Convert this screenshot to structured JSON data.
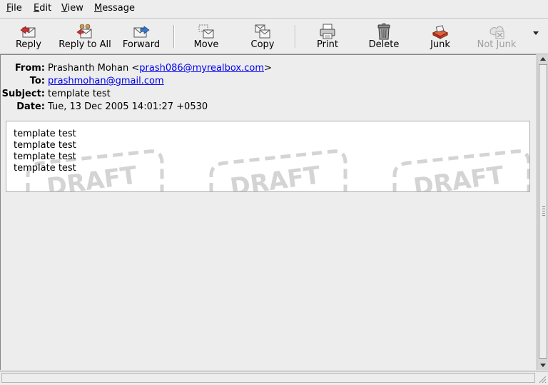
{
  "menu": {
    "file": "File",
    "edit": "Edit",
    "view": "View",
    "message": "Message"
  },
  "toolbar": {
    "reply": "Reply",
    "reply_all": "Reply to All",
    "forward": "Forward",
    "move": "Move",
    "copy": "Copy",
    "print": "Print",
    "delete": "Delete",
    "junk": "Junk",
    "not_junk": "Not Junk"
  },
  "header": {
    "from_label": "From:",
    "from_name": "Prashanth Mohan <",
    "from_email": "prash086@myrealbox.com",
    "from_close": ">",
    "to_label": "To:",
    "to_email": "prashmohan@gmail.com",
    "subject_label": "Subject:",
    "subject": "template test",
    "date_label": "Date:",
    "date": "Tue, 13 Dec 2005 14:01:27 +0530"
  },
  "body": {
    "lines": [
      "template test",
      "template test",
      "template test",
      "template test"
    ],
    "watermark": "DRAFT"
  },
  "colors": {
    "link": "#0000ee",
    "disabled_text": "#a0a0a0"
  }
}
